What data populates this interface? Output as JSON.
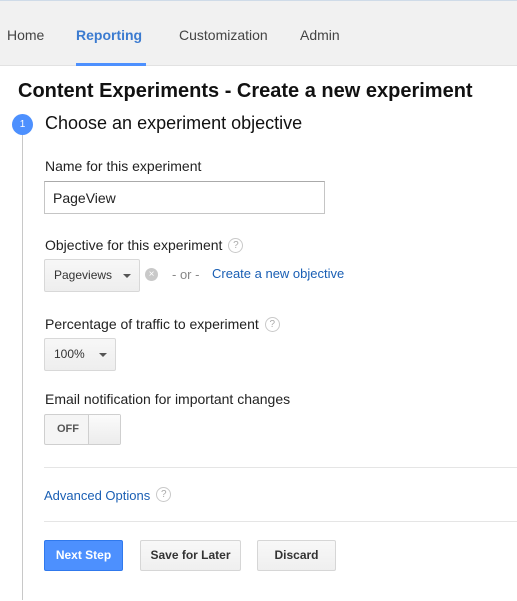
{
  "nav": {
    "tabs": [
      {
        "label": "Home"
      },
      {
        "label": "Reporting"
      },
      {
        "label": "Customization"
      },
      {
        "label": "Admin"
      }
    ],
    "active_tab": "Reporting"
  },
  "page": {
    "title": "Content Experiments - Create a new experiment"
  },
  "step": {
    "number": "1",
    "title": "Choose an experiment objective"
  },
  "form": {
    "name": {
      "label": "Name for this experiment",
      "value": "PageView"
    },
    "objective": {
      "label": "Objective for this experiment",
      "selected": "Pageviews",
      "or_text": "- or -",
      "create_link": "Create a new objective"
    },
    "traffic": {
      "label": "Percentage of traffic to experiment",
      "selected": "100%"
    },
    "email": {
      "label": "Email notification for important changes",
      "toggle_state": "OFF"
    },
    "advanced_link": "Advanced Options"
  },
  "help_glyph": "?",
  "clear_glyph": "×",
  "buttons": {
    "next": "Next Step",
    "save": "Save for Later",
    "discard": "Discard"
  },
  "colors": {
    "accent": "#4d90fe",
    "link": "#1a5fb4",
    "active_tab": "#3b7bd0"
  },
  "icons": [
    "help-icon",
    "clear-icon",
    "chevron-down-icon"
  ]
}
